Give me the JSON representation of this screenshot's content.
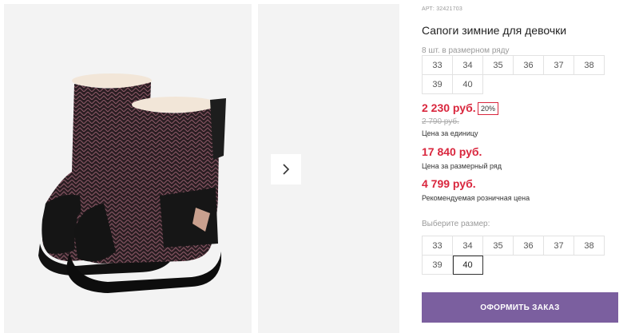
{
  "product": {
    "article": "АРТ: 32421703",
    "title": "Сапоги зимние для девочки",
    "pack_label": "8 шт. в размерном ряду",
    "pack_sizes": [
      "33",
      "34",
      "35",
      "36",
      "37",
      "38",
      "39",
      "40"
    ],
    "price_unit": "2 230 руб.",
    "discount_badge": "20%",
    "old_price": "2 790 руб.",
    "price_unit_caption": "Цена за единицу",
    "price_row": "17 840 руб.",
    "price_row_caption": "Цена за размерный ряд",
    "price_retail": "4 799 руб.",
    "price_retail_caption": "Рекомендуемая розничная цена",
    "choose_size_label": "Выберите размер:",
    "sizes": [
      "33",
      "34",
      "35",
      "36",
      "37",
      "38",
      "39",
      "40"
    ],
    "selected_size": "40",
    "order_button": "ОФОРМИТЬ ЗАКАЗ"
  },
  "gallery": {
    "next_icon": "chevron-right-icon"
  },
  "colors": {
    "accent": "#7b5f9f",
    "price": "#d9263d"
  }
}
